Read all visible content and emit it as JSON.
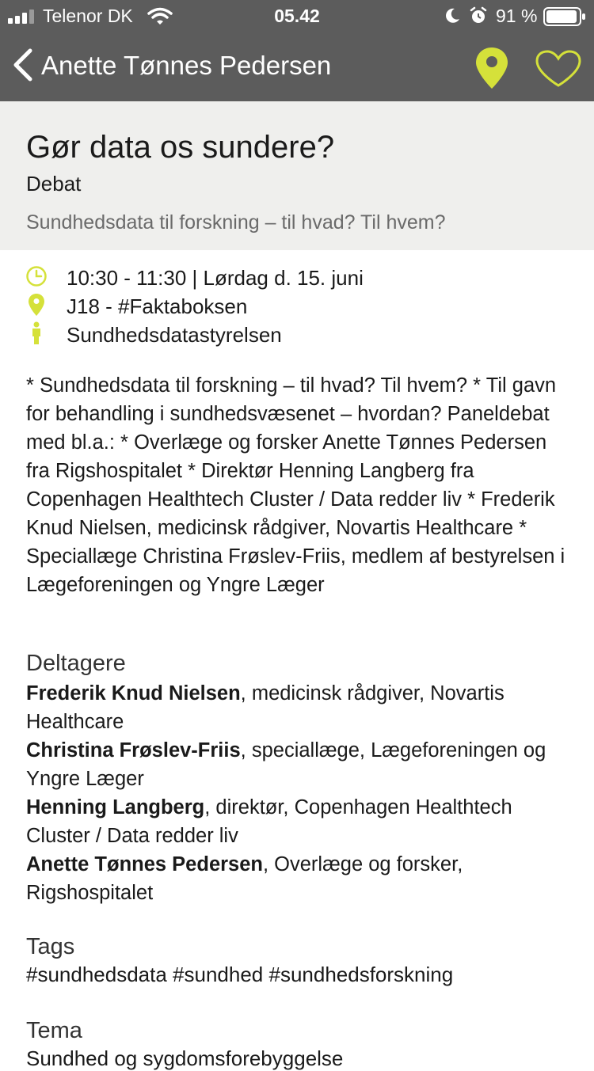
{
  "status_bar": {
    "carrier": "Telenor DK",
    "time": "05.42",
    "battery": "91 %"
  },
  "nav": {
    "title": "Anette Tønnes Pedersen",
    "icons": [
      "back-chevron-icon",
      "location-pin-icon",
      "heart-icon"
    ]
  },
  "event": {
    "title": "Gør data os sundere?",
    "type": "Debat",
    "subtitle": "Sundhedsdata til forskning – til hvad? Til hvem?",
    "time": "10:30 - 11:30 | Lørdag d. 15. juni",
    "location": "J18 - #Faktaboksen",
    "organizer": "Sundhedsdatastyrelsen",
    "description": "* Sundhedsdata til forskning – til hvad? Til hvem? * Til gavn for behandling i sundhedsvæsenet – hvordan? Paneldebat med bl.a.: * Overlæge og forsker Anette Tønnes Pedersen fra Rigshospitalet * Direktør Henning Langberg fra Copenhagen Healthtech Cluster / Data redder liv * Frederik Knud Nielsen, medicinsk rådgiver, Novartis Healthcare * Speciallæge Christina Frøslev-Friis, medlem af bestyrelsen i Lægeforeningen og Yngre Læger"
  },
  "participants": {
    "heading": "Deltagere",
    "items": [
      {
        "name": "Frederik Knud Nielsen",
        "detail": ", medicinsk rådgiver, Novartis Healthcare"
      },
      {
        "name": "Christina Frøslev-Friis",
        "detail": ", speciallæge, Lægeforeningen og Yngre Læger"
      },
      {
        "name": "Henning Langberg",
        "detail": ", direktør, Copenhagen Healthtech Cluster / Data redder liv"
      },
      {
        "name": "Anette Tønnes Pedersen",
        "detail": ", Overlæge og forsker, Rigshospitalet"
      }
    ]
  },
  "tags": {
    "heading": "Tags",
    "text": "#sundhedsdata #sundhed #sundhedsforskning"
  },
  "tema": {
    "heading": "Tema",
    "text": "Sundhed og sygdomsforebyggelse"
  },
  "colors": {
    "topbar": "#5c5c5c",
    "header_band": "#efefed",
    "accent": "#d5e13a"
  }
}
